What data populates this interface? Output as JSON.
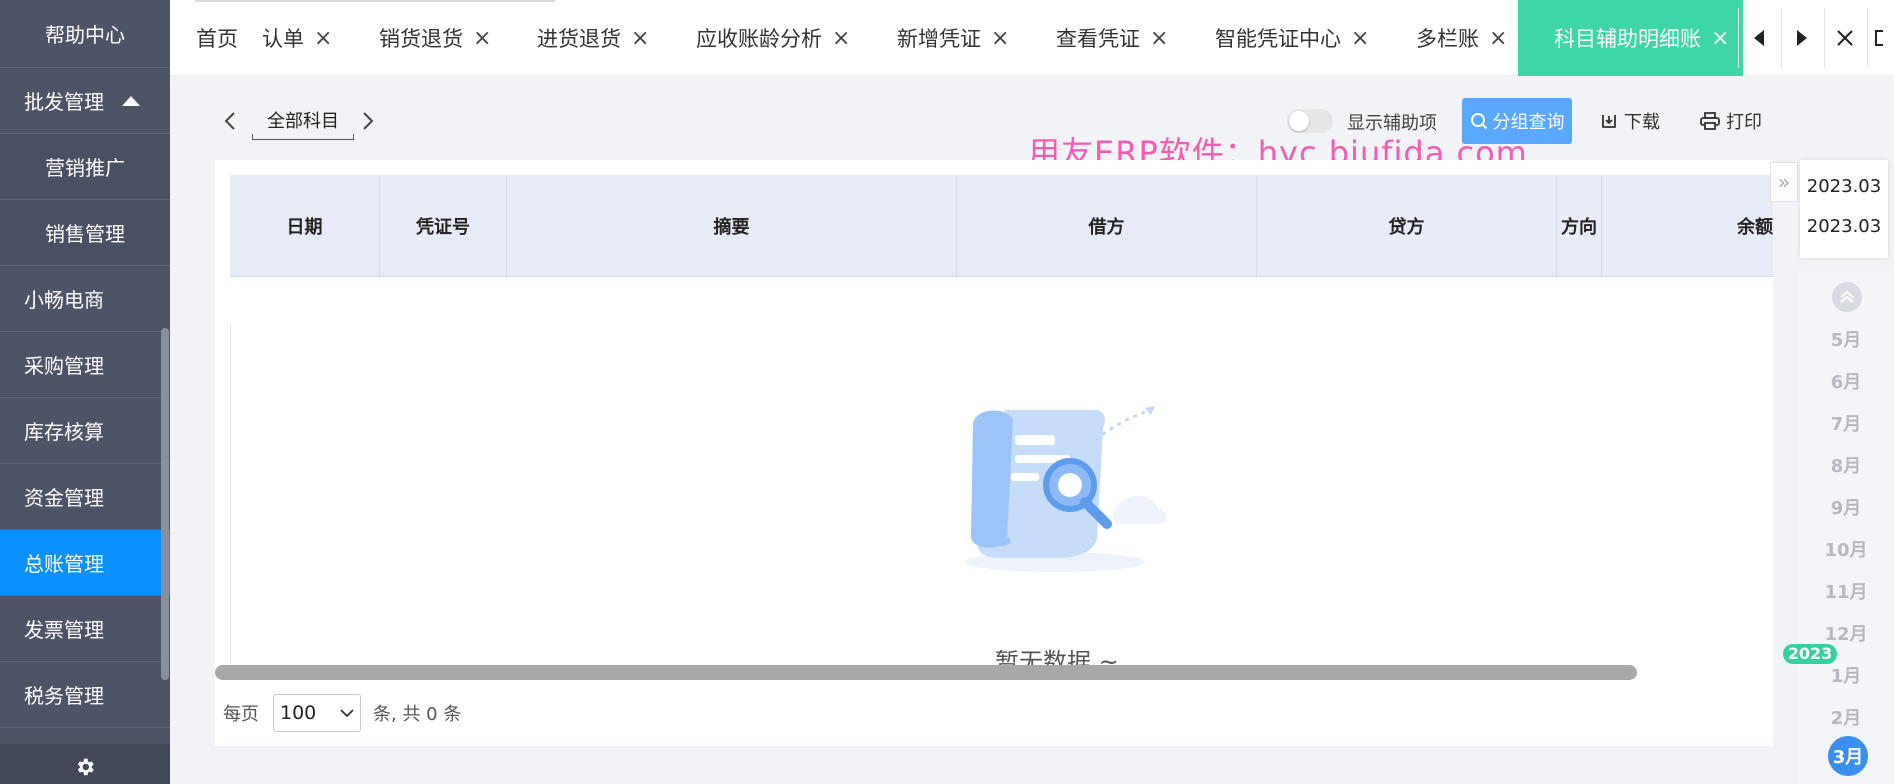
{
  "sidebar": {
    "items": [
      {
        "label": "帮助中心",
        "type": "sub"
      },
      {
        "label": "批发管理",
        "type": "group"
      },
      {
        "label": "营销推广",
        "type": "sub"
      },
      {
        "label": "销售管理",
        "type": "sub"
      },
      {
        "label": "小畅电商",
        "type": "item"
      },
      {
        "label": "采购管理",
        "type": "item"
      },
      {
        "label": "库存核算",
        "type": "item"
      },
      {
        "label": "资金管理",
        "type": "item"
      },
      {
        "label": "总账管理",
        "type": "active"
      },
      {
        "label": "发票管理",
        "type": "item"
      },
      {
        "label": "税务管理",
        "type": "item"
      }
    ]
  },
  "tabs": [
    {
      "label": "首页"
    },
    {
      "label": "认单"
    },
    {
      "label": "销货退货"
    },
    {
      "label": "进货退货"
    },
    {
      "label": "应收账龄分析"
    },
    {
      "label": "新增凭证"
    },
    {
      "label": "查看凭证"
    },
    {
      "label": "智能凭证中心"
    },
    {
      "label": "多栏账"
    },
    {
      "label": "科目辅助明细账"
    }
  ],
  "toolbar": {
    "subject": "全部科目",
    "toggle_label": "显示辅助项",
    "toggle_on": false,
    "group_query": "分组查询",
    "download": "下载",
    "print": "打印"
  },
  "watermark": "用友ERP软件：hyc.bjufida.com",
  "table": {
    "columns": [
      "日期",
      "凭证号",
      "摘要",
      "借方",
      "贷方",
      "方向",
      "余额"
    ],
    "empty_text": "暂无数据 ~"
  },
  "pager": {
    "prefix": "每页",
    "page_size": "100",
    "suffix": "条, 共 0 条"
  },
  "date_panel": {
    "start": "2023.03",
    "end": "2023.03",
    "months": [
      "5月",
      "6月",
      "7月",
      "8月",
      "9月",
      "10月",
      "11月",
      "12月",
      "1月",
      "2月"
    ],
    "year": "2023",
    "current_month": "3月"
  },
  "colors": {
    "sidebar_bg": "#4e5468",
    "sidebar_active": "#0a90ff",
    "tab_active": "#3ed6a9",
    "primary_button": "#5aa7ff",
    "watermark": "#f35bb4"
  }
}
